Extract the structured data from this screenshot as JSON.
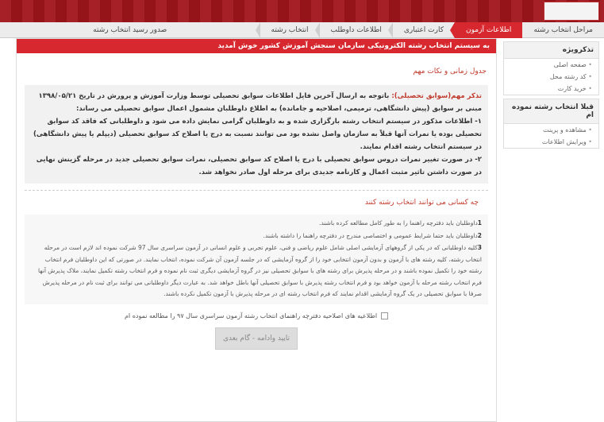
{
  "header": {
    "logo_icon": "organization-logo-icon"
  },
  "steps": [
    {
      "label": "مراحل انتخاب رشته",
      "active": false
    },
    {
      "label": "اطلاعات آزمون",
      "active": true
    },
    {
      "label": "کارت اعتباری",
      "active": false
    },
    {
      "label": "اطلاعات داوطلب",
      "active": false
    },
    {
      "label": "انتخاب رشته",
      "active": false
    },
    {
      "label": "صدور رسید انتخاب رشته",
      "active": false
    }
  ],
  "sidebar": {
    "block1_title": "تذکرویژه",
    "block1_items": [
      "صفحه اصلی",
      "کد رشته محل",
      "خرید کارت"
    ],
    "block2_title": "قبلا انتخاب رشته نموده ام",
    "block2_items": [
      "مشاهده و پرینت",
      "ویرایش اطلاعات"
    ]
  },
  "main": {
    "welcome": "به سیستم انتخاب رشته الکترونیکی سازمان سنجش آموزش کشور خوش آمدید",
    "schedule_title": "جدول زمانی و نکات مهم",
    "notice_highlight": "تذکر مهم(سوابق تحصیلی):",
    "notice_text": " باتوجه به ارسال آخرین فایل اطلاعات سوابق تحصیلی توسط وزارت آموزش و پرورش در تاریخ ۱۳۹۸/۰۵/۲۱ مبنی بر سوابق (پیش دانشگاهی، ترمیمی، اصلاحیه و جامانده) به اطلاع داوطلبان مشمول اعمال سوابق تحصیلی می رساند:",
    "notice_point1": "۱- اطلاعات مذکور در سیستم انتخاب رشته بارگزاری شده و به داوطلبان گرامی نمایش داده می شود و داوطلبانی که فاقد کد سوابق تحصیلی بوده یا نمرات آنها قبلاً به سازمان واصل نشده بود می توانند نسبت به درج یا اصلاح کد سوابق تحصیلی (دیپلم یا پیش دانشگاهی) در سیستم انتخاب رشته اقدام نمایند.",
    "notice_point2": "۲- در صورت تغییر نمرات دروس سوابق تحصیلی با درج یا اصلاح کد سوابق تحصیلی، نمرات سوابق تحصیلی جدید در مرحله گزینش نهایی در صورت داشتن تاثیر مثبت اعمال و کارنامه جدیدی برای مرحله اول صادر نخواهد شد.",
    "who_title": "چه کسانی می توانند انتخاب رشته کنند",
    "rule1": "داوطلبان باید دفترچه راهنما را به طور کامل مطالعه کرده باشند.",
    "rule2": "داوطلبان باید حتما شرایط عمومی و اختصاصی مندرج در دفترچه راهنما را داشته باشند.",
    "rule3": "کلیه داوطلبانی که در یکی از گروههای آزمایشی اصلی شامل علوم ریاضی و فنی، علوم تجربی و علوم انسانی در آزمون سراسری سال 97 شرکت نموده اند لازم است در مرحله انتخاب رشته، کلیه رشته های با آزمون و بدون آزمون انتخابی خود را از گروه آزمایشی که در جلسه آزمون آن شرکت نموده، انتخاب نمایند. در صورتی که این داوطلبان فرم انتخاب رشته خود را تکمیل نموده باشند و در مرحله پذیرش برای رشته های با سوابق تحصیلی نیز در گروه آزمایشی دیگری ثبت نام نموده و فرم انتخاب رشته تکمیل نمایند، ملاک پذیرش آنها فرم انتخاب رشته مرحله با آزمون خواهد بود و فرم انتخاب رشته پذیرش با سوابق تحصیلی آنها باطل خواهد شد. به عبارت دیگر داوطلبانی می توانند برای ثبت نام در مرحله پذیرش صرفا با سوابق تحصیلی در یک گروه آزمایشی اقدام نمایند که فرم انتخاب رشته ای در مرحله پذیرش با آزمون تکمیل نکرده باشند.",
    "rule_numbers": [
      "1",
      "2",
      "3"
    ],
    "agree_label": "اطلاعیه های اصلاحیه دفترچه راهنمای انتخاب رشته آزمون سراسری سال ۹۷ را مطالعه نموده ام",
    "submit_label": "تایید وادامه - گام بعدی"
  }
}
